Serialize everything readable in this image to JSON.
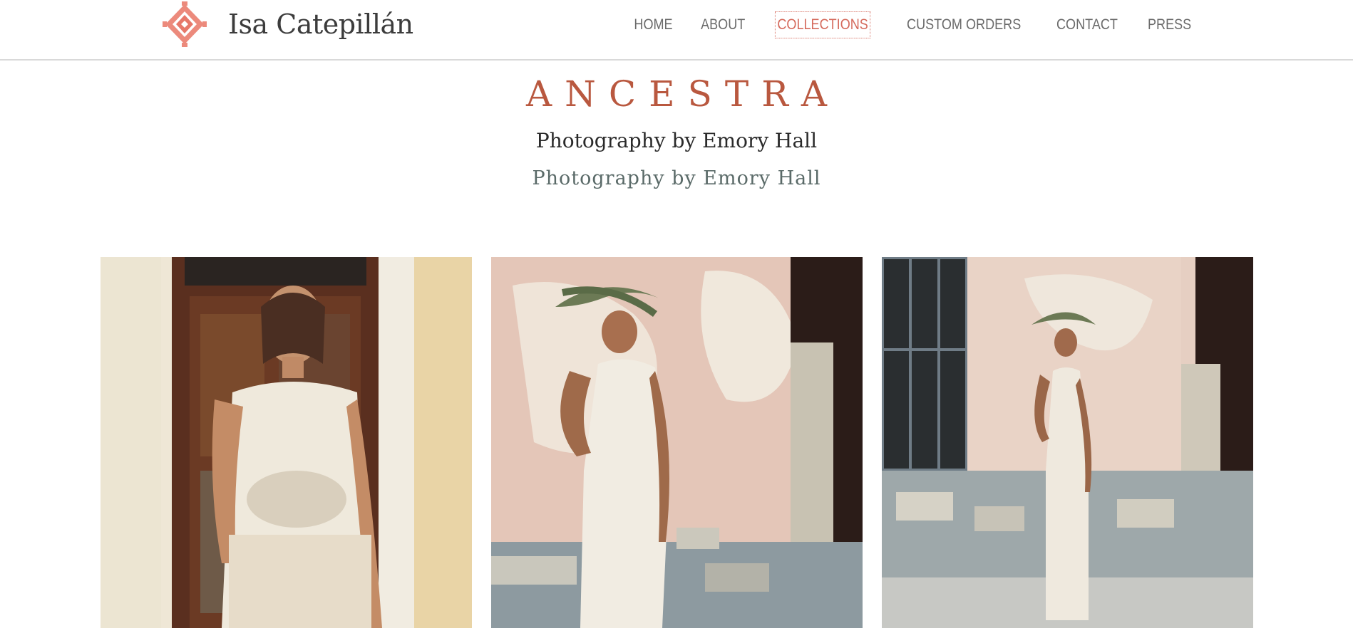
{
  "header": {
    "brand_name": "Isa Catepillán",
    "logo_icon": "aztec-diamond-logo-icon",
    "nav": [
      {
        "label": "HOME",
        "active": false
      },
      {
        "label": "ABOUT",
        "active": false
      },
      {
        "label": "COLLECTIONS",
        "active": true
      },
      {
        "label": "CUSTOM ORDERS",
        "active": false
      },
      {
        "label": "CONTACT",
        "active": false
      },
      {
        "label": "PRESS",
        "active": false
      }
    ]
  },
  "collection": {
    "title": "ANCESTRA",
    "credit_primary": "Photography by Emory Hall",
    "credit_secondary": "Photography by Emory Hall"
  },
  "gallery": {
    "photos": [
      {
        "subject": "model-in-crochet-dress-at-wooden-door"
      },
      {
        "subject": "model-in-crochet-gown-with-olive-crown-against-wall"
      },
      {
        "subject": "model-full-length-by-window-and-stone-wall"
      }
    ]
  },
  "colors": {
    "accent": "#d56a5c",
    "title": "#b9583f",
    "nav_text": "#6a6a6a",
    "header_border": "#d9d9d9"
  }
}
